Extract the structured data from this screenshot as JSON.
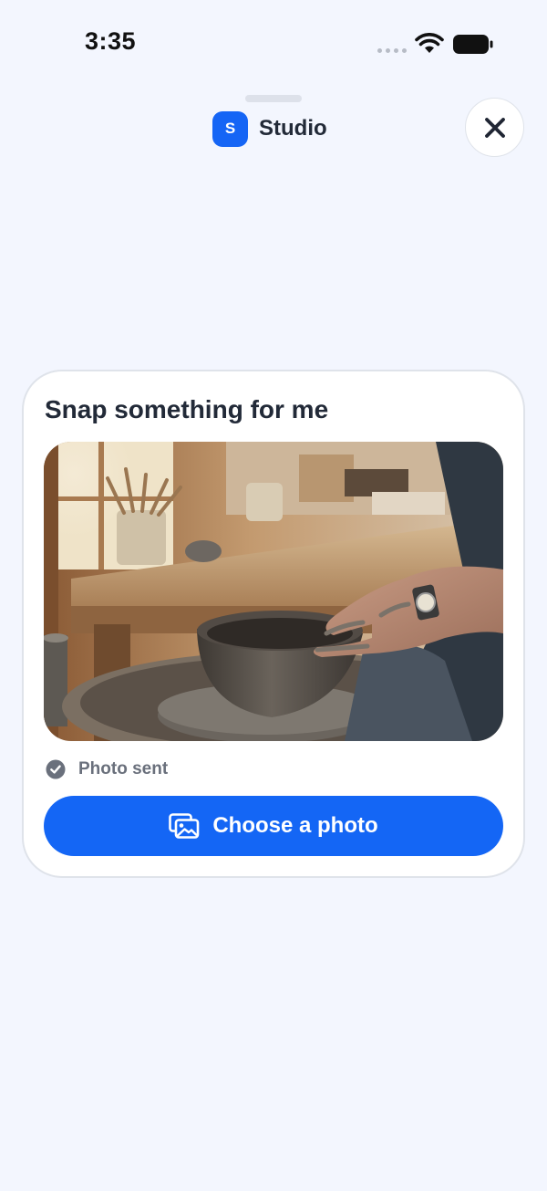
{
  "status_bar": {
    "time": "3:35"
  },
  "header": {
    "app_initial": "S",
    "app_name": "Studio",
    "close_icon": "close-icon"
  },
  "card": {
    "title": "Snap something for me",
    "photo_alt": "Hands shaping a clay bowl on a pottery wheel",
    "status_icon": "check-circle-icon",
    "status_text": "Photo sent",
    "button_icon": "photo-gallery-icon",
    "button_label": "Choose a photo"
  },
  "colors": {
    "background": "#f3f6fe",
    "accent": "#1466f5",
    "text": "#222a38",
    "muted": "#6a707c"
  }
}
